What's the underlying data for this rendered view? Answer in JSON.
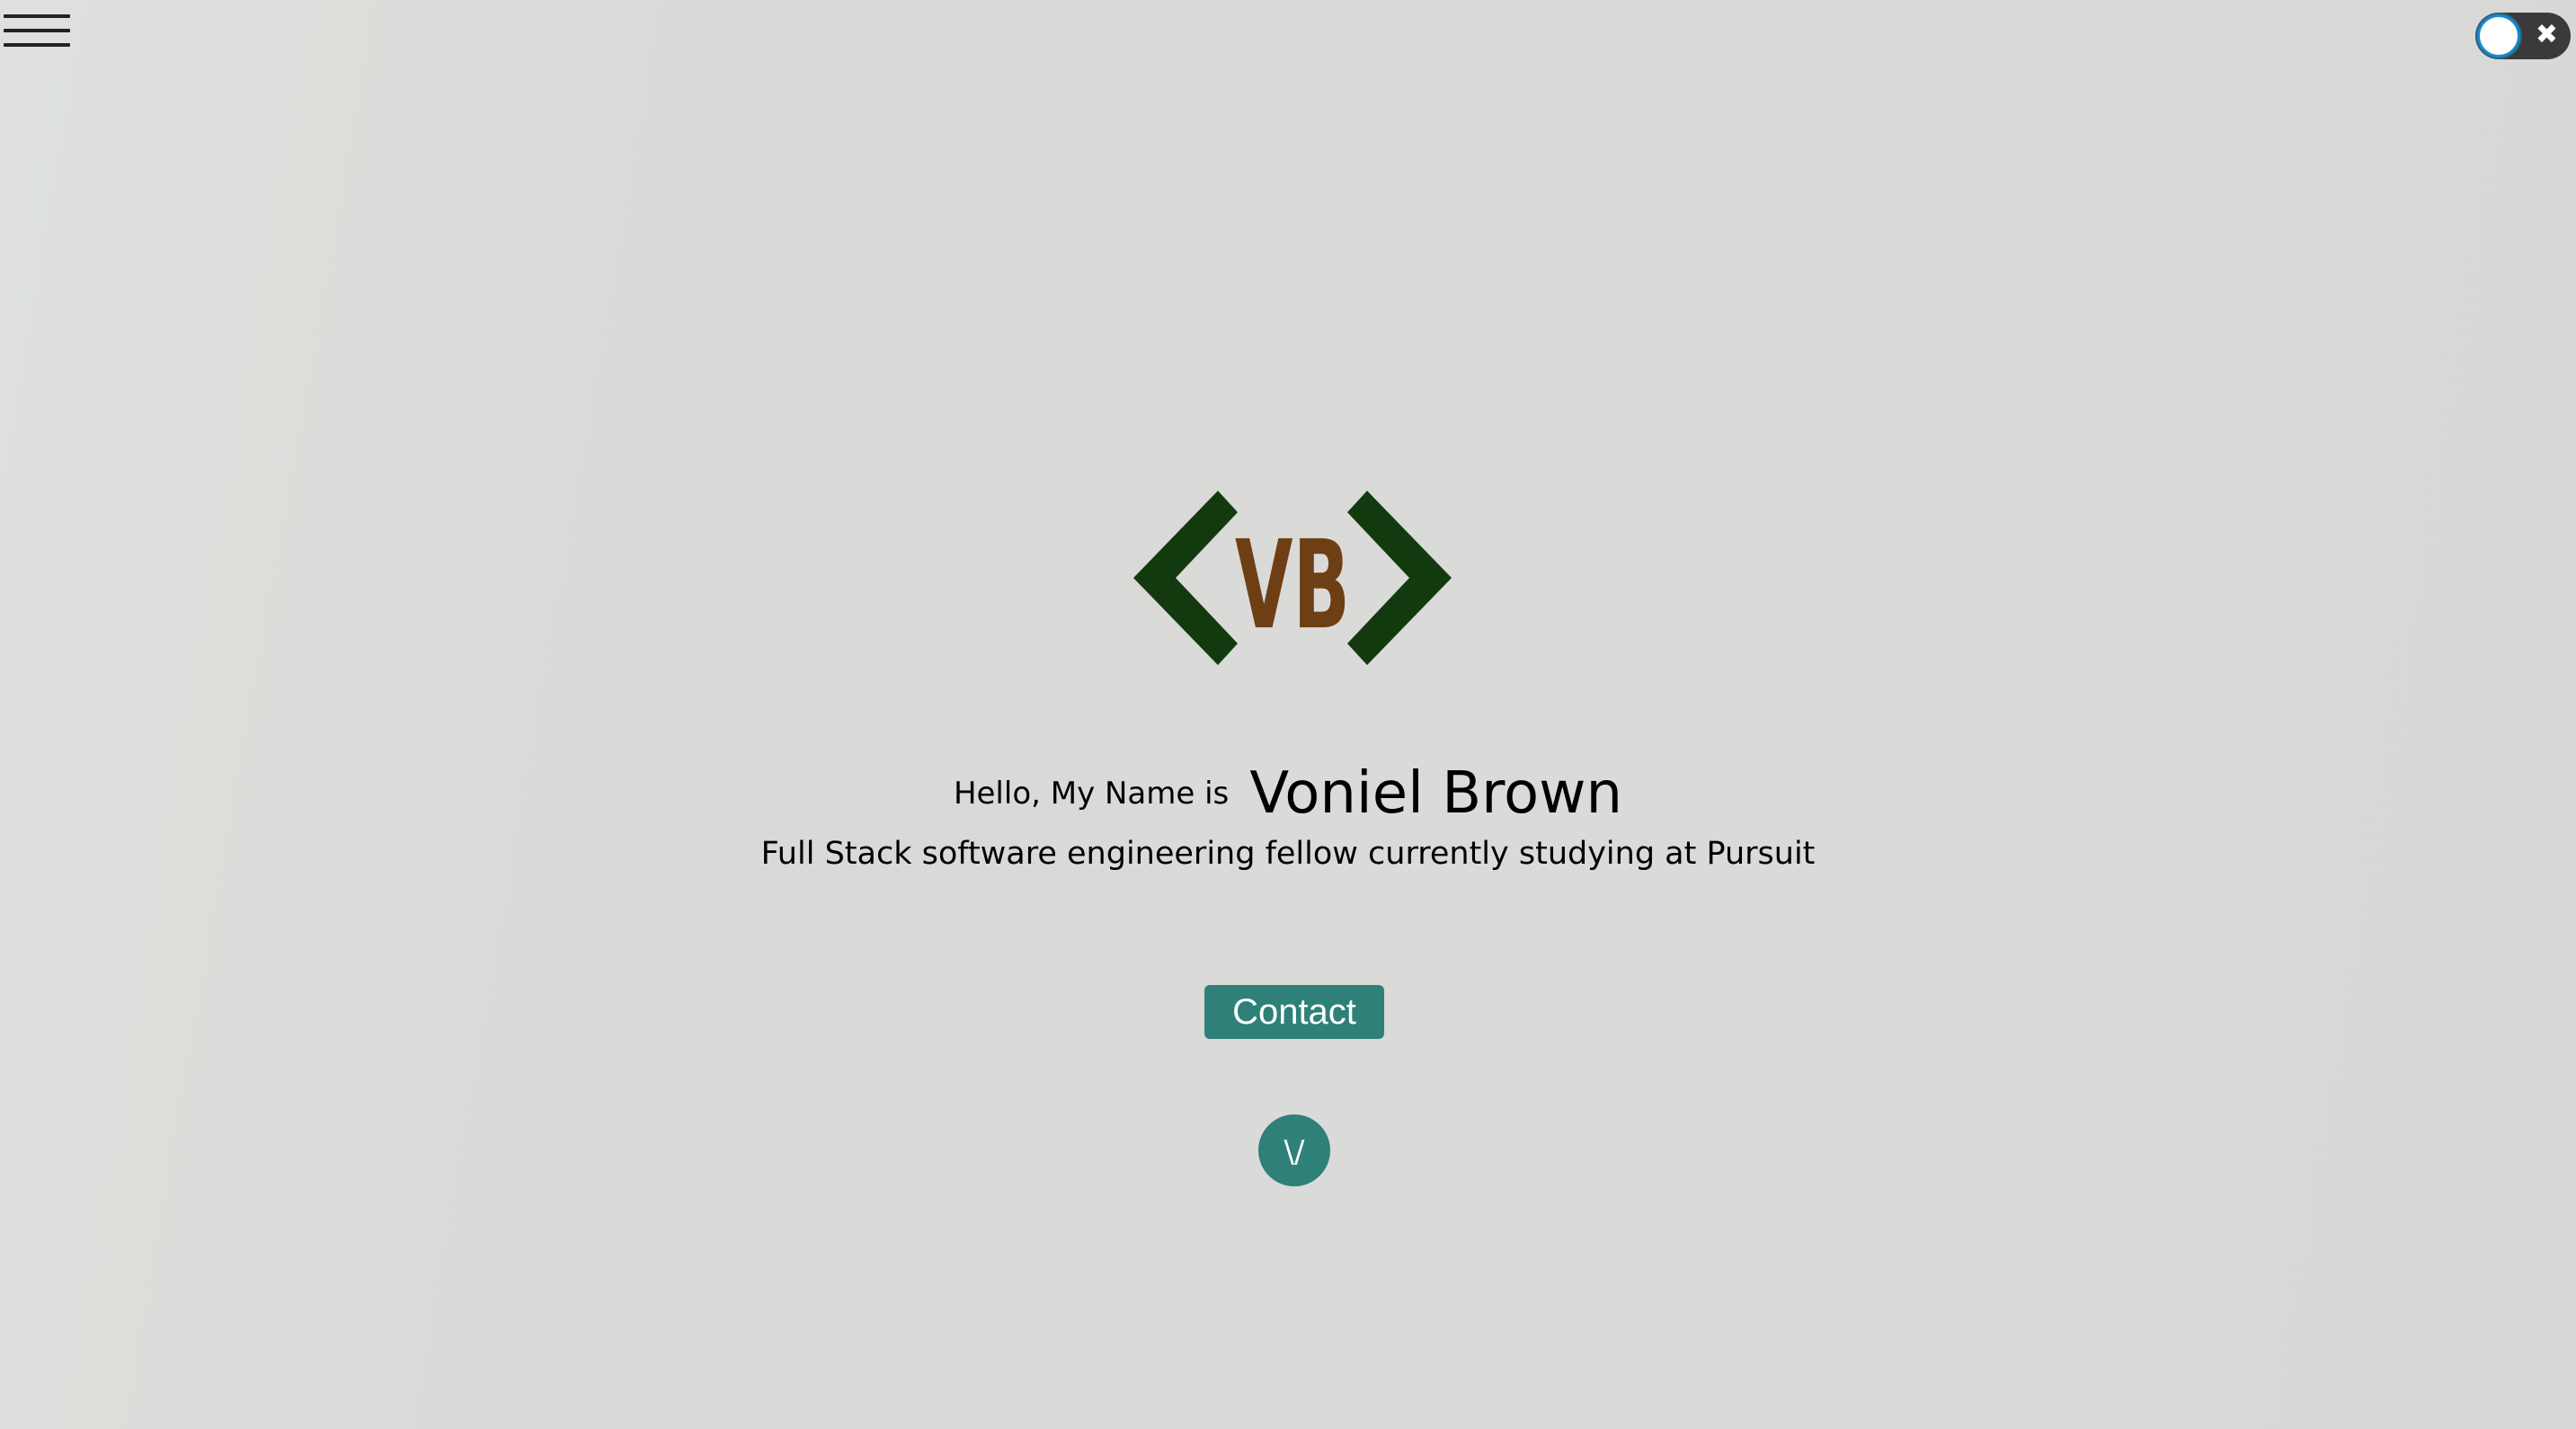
{
  "header": {
    "menu_icon": "hamburger-menu-icon",
    "theme_toggle": {
      "state": "off",
      "icon": "close-icon",
      "symbol": "✖"
    }
  },
  "logo": {
    "text": "VB",
    "bracket_color": "#133a0f",
    "text_color": "#6e3f14"
  },
  "hero": {
    "greeting": "Hello, My Name is",
    "name": "Voniel Brown",
    "tagline": "Full Stack software engineering fellow currently studying at Pursuit"
  },
  "contact_button": {
    "label": "Contact"
  },
  "scroll_down_button": {
    "label": "\\/"
  },
  "colors": {
    "accent": "#2e8079",
    "background": "#d9d9d8"
  }
}
